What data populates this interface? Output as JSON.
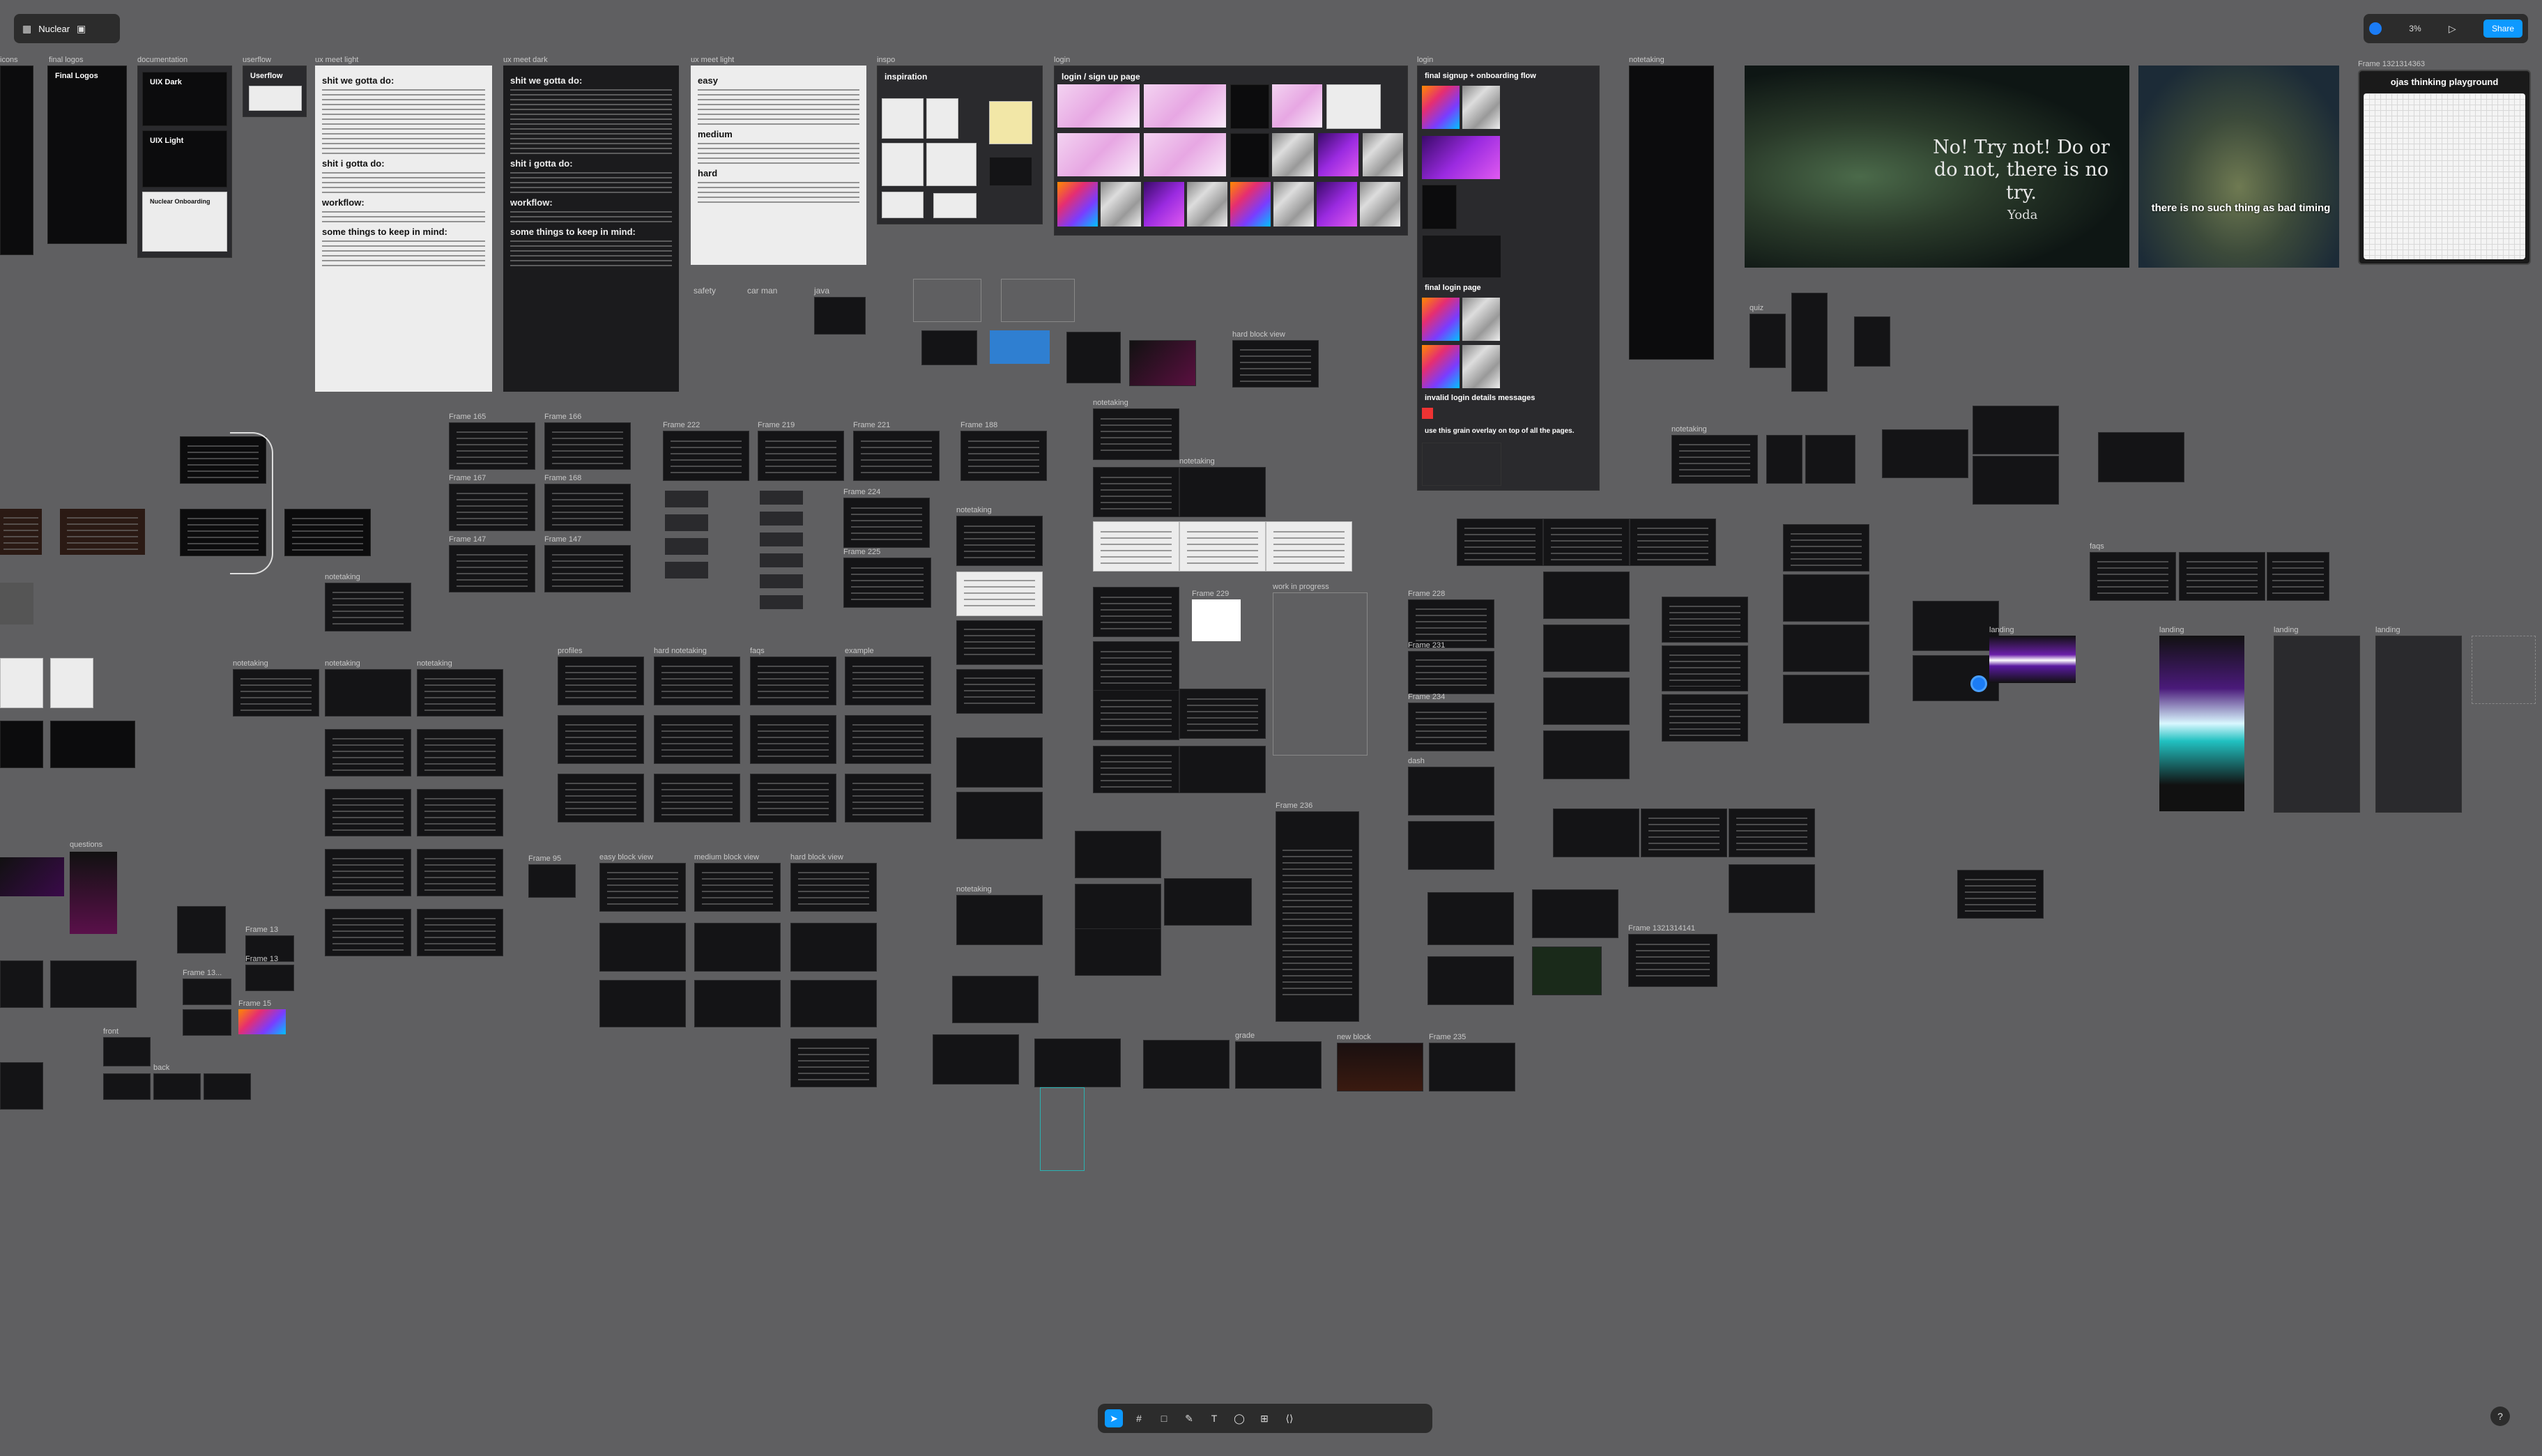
{
  "app": {
    "project_name": "Nuclear",
    "zoom": "3%",
    "share_label": "Share",
    "help_label": "?"
  },
  "top_labels": {
    "icons": "icons",
    "final_logos": "final logos",
    "documentation": "documentation",
    "userflow": "userflow",
    "uxmeet_light": "ux meet light",
    "uxmeet_dark": "ux meet dark",
    "uxmeet_light2": "ux meet light",
    "inspo": "inspo",
    "login": "login",
    "login2": "login",
    "notetaking": "notetaking",
    "frame_playground": "Frame 1321314363"
  },
  "cards": {
    "final_logos_title": "Final Logos",
    "uix_dark": "UIX Dark",
    "uix_light": "UIX Light",
    "nuclear_onboarding": "Nuclear Onboarding",
    "userflow_title": "Userflow",
    "gotta_do": "shit we gotta do:",
    "gotta_do2": "shit we gotta do:",
    "shit_i_gotta_do": "shit i gotta do:",
    "shit_i_gotta_do2": "shit i gotta do:",
    "workflow": "workflow:",
    "workflow2": "workflow:",
    "keep_in_mind": "some things to keep in mind:",
    "keep_in_mind2": "some things to keep in mind:",
    "easy": "easy",
    "medium": "medium",
    "hard": "hard",
    "inspiration": "inspiration",
    "login_signup": "login / sign up page",
    "final_signup": "final signup + onboarding flow",
    "final_login": "final login page",
    "invalid_login": "invalid login details messages",
    "grain_overlay": "use this grain overlay on top of all the pages.",
    "safety": "safety",
    "car_man": "car man",
    "java": "java",
    "hard_block_view": "hard block view"
  },
  "quotes": {
    "yoda_text": "No! Try not! Do or do not, there is no try.",
    "yoda_by": "Yoda",
    "oogway_text": "there is no such thing as bad timing",
    "playground_title": "ojas thinking playground"
  },
  "frames": {
    "f165": "Frame 165",
    "f166": "Frame 166",
    "f167": "Frame 167",
    "f168": "Frame 168",
    "f147a": "Frame 147",
    "f147b": "Frame 147",
    "f222": "Frame 222",
    "f219": "Frame 219",
    "f221": "Frame 221",
    "f188": "Frame 188",
    "f224": "Frame 224",
    "f225": "Frame 225",
    "f229": "Frame 229",
    "f228": "Frame 228",
    "f231": "Frame 231",
    "f234": "Frame 234",
    "f235": "Frame 235",
    "f236": "Frame 236",
    "f1321314141": "Frame 1321314141",
    "f13a": "Frame 13",
    "f13b": "Frame 13",
    "f13c": "Frame 13...",
    "f15": "Frame 15",
    "f95": "Frame 95"
  },
  "section_labels": {
    "notetaking": "notetaking",
    "quiz": "quiz",
    "landing": "landing",
    "profiles": "profiles",
    "faqs": "faqs",
    "example": "example",
    "hard_notetaking": "hard notetaking",
    "easy_block_view": "easy block view",
    "medium_block_view": "medium block view",
    "hard_block_view": "hard block view",
    "work_in_progress": "work in progress",
    "dash": "dash",
    "new_block": "new block",
    "grade": "grade",
    "unit": "unit",
    "front": "front",
    "back": "back",
    "questions": "questions"
  }
}
